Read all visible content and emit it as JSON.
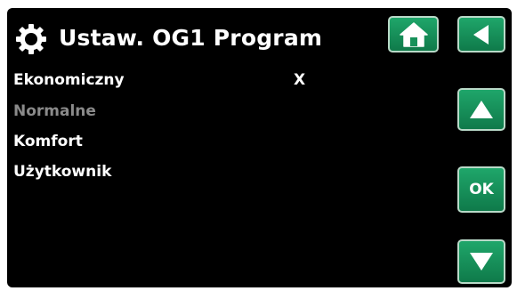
{
  "header": {
    "title": "Ustaw. OG1 Program",
    "settings_icon": "gear-icon"
  },
  "nav": {
    "home_icon": "home-icon",
    "back_icon": "back-arrow-icon",
    "up_icon": "arrow-up-icon",
    "ok_label": "OK",
    "down_icon": "arrow-down-icon",
    "button_color": "#17915a"
  },
  "menu": {
    "items": [
      {
        "label": "Ekonomiczny",
        "selected": true,
        "enabled": true
      },
      {
        "label": "Normalne",
        "selected": false,
        "enabled": false
      },
      {
        "label": "Komfort",
        "selected": false,
        "enabled": true
      },
      {
        "label": "Użytkownik",
        "selected": false,
        "enabled": true
      }
    ],
    "selected_marker": "X"
  },
  "colors": {
    "background": "#000000",
    "text": "#ffffff",
    "disabled_text": "#8a8a8a"
  }
}
